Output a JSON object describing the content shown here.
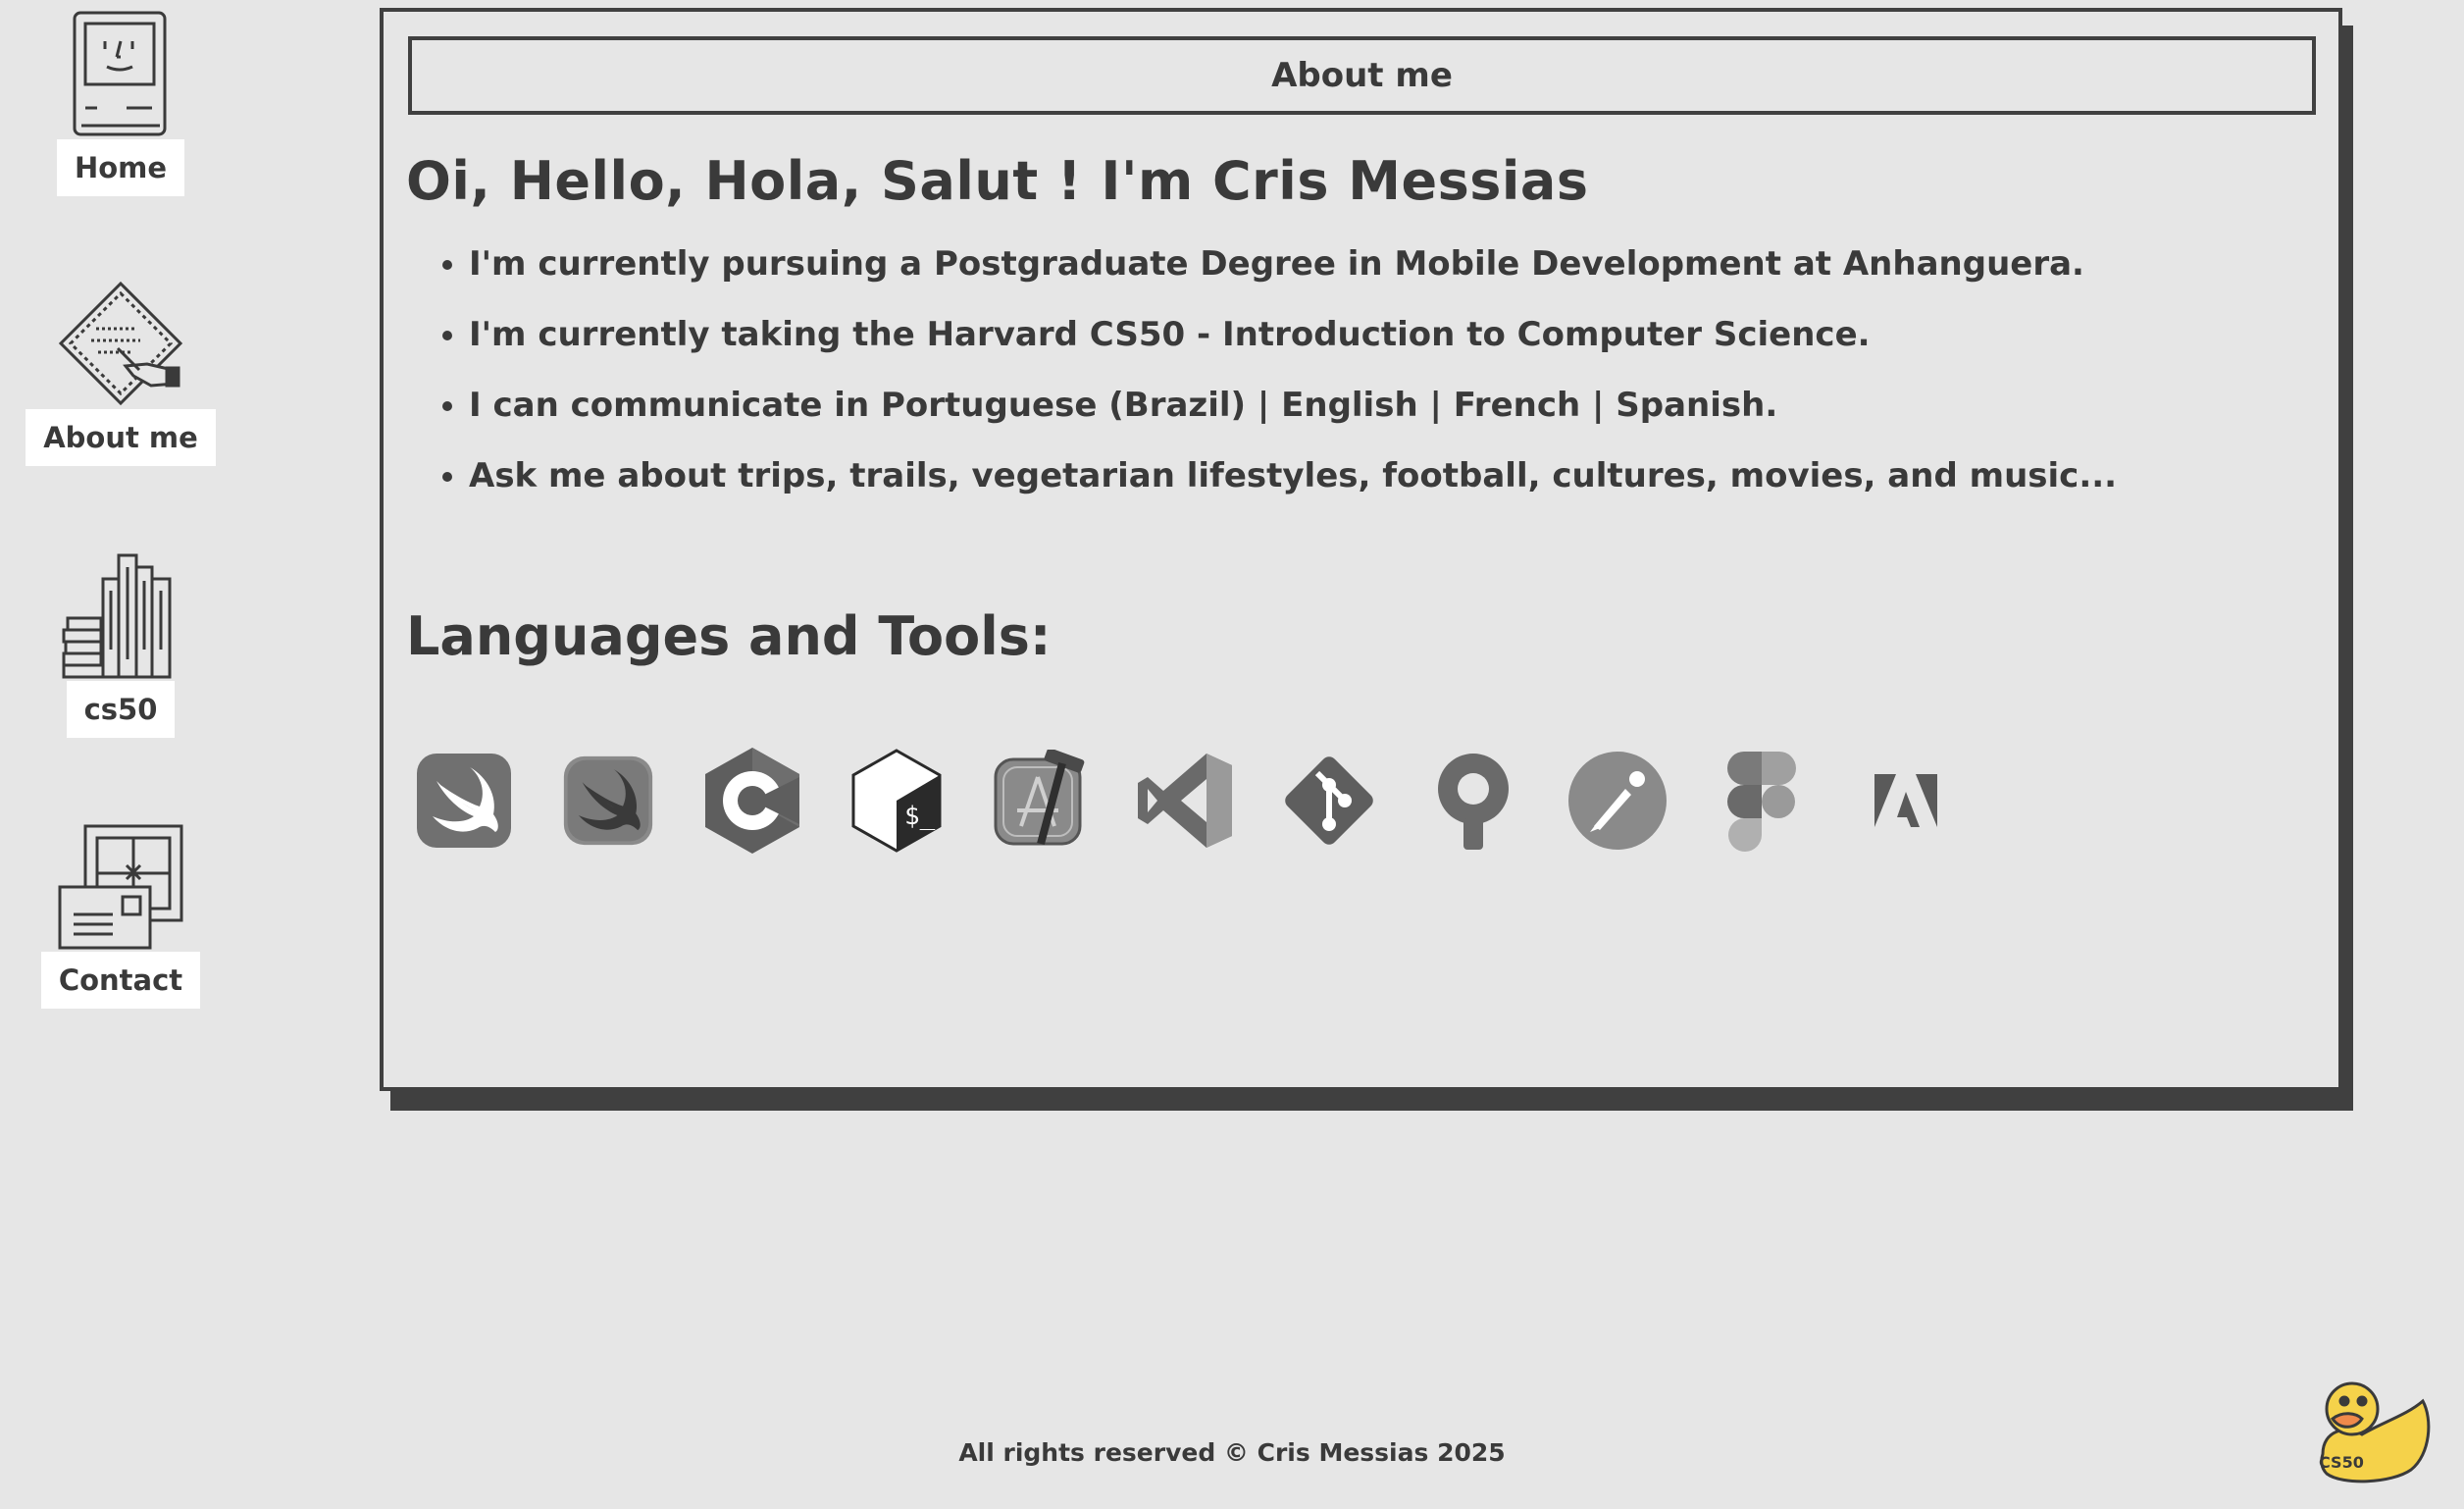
{
  "desktop_icons": [
    {
      "label": "Home",
      "icon": "classic-mac-icon"
    },
    {
      "label": "About me",
      "icon": "hand-writing-icon"
    },
    {
      "label": "cs50",
      "icon": "books-icon"
    },
    {
      "label": "Contact",
      "icon": "mailbox-icon"
    }
  ],
  "window": {
    "title": "About me",
    "greeting": "Oi, Hello, Hola, Salut ! I'm Cris Messias",
    "bullets": [
      "I'm currently pursuing a Postgraduate Degree in Mobile Development at Anhanguera.",
      "I'm currently taking the Harvard CS50 - Introduction to Computer Science.",
      "I can communicate in Portuguese (Brazil) | English | French | Spanish.",
      "Ask me about trips, trails, vegetarian lifestyles, football, cultures, movies, and music..."
    ],
    "tools_heading": "Languages and Tools:",
    "tools": [
      {
        "icon": "swift-icon"
      },
      {
        "icon": "swiftui-icon"
      },
      {
        "icon": "c-language-icon"
      },
      {
        "icon": "bash-icon"
      },
      {
        "icon": "xcode-icon"
      },
      {
        "icon": "vscode-icon"
      },
      {
        "icon": "git-icon"
      },
      {
        "icon": "sourcetree-icon"
      },
      {
        "icon": "postman-icon"
      },
      {
        "icon": "figma-icon"
      },
      {
        "icon": "adobe-icon"
      }
    ]
  },
  "footer": {
    "text": "All rights reserved © Cris Messias 2025"
  },
  "duck_badge": {
    "text": "CS50",
    "icon": "rubber-duck-icon"
  },
  "colors": {
    "background": "#e6e6e6",
    "ink": "#3a3a3a",
    "border": "#404040",
    "label_bg": "#ffffff",
    "duck_yellow": "#f5d24a"
  }
}
